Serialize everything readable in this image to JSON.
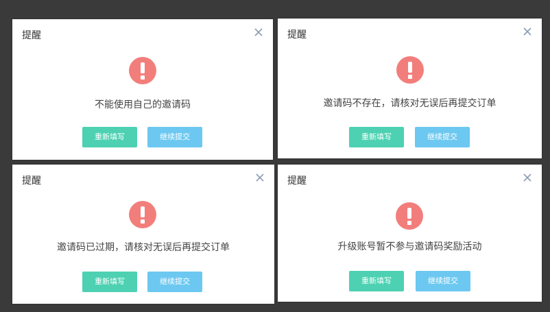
{
  "colors": {
    "background": "#3a3a3a",
    "dialog": "#ffffff",
    "alert_icon": "#f27e7c",
    "refill_button": "#4dd1b2",
    "continue_button": "#6cc8f0"
  },
  "icons": {
    "close": "close-icon",
    "alert": "exclamation-alert-icon"
  },
  "dialogs": [
    {
      "title": "提醒",
      "message": "不能使用自己的邀请码",
      "refill_label": "重新填写",
      "continue_label": "继续提交"
    },
    {
      "title": "提醒",
      "message": "邀请码不存在，请核对无误后再提交订单",
      "refill_label": "重新填写",
      "continue_label": "继续提交"
    },
    {
      "title": "提醒",
      "message": "邀请码已过期，请核对无误后再提交订单",
      "refill_label": "重新填写",
      "continue_label": "继续提交"
    },
    {
      "title": "提醒",
      "message": "升级账号暂不参与邀请码奖励活动",
      "refill_label": "重新填写",
      "continue_label": "继续提交"
    }
  ]
}
